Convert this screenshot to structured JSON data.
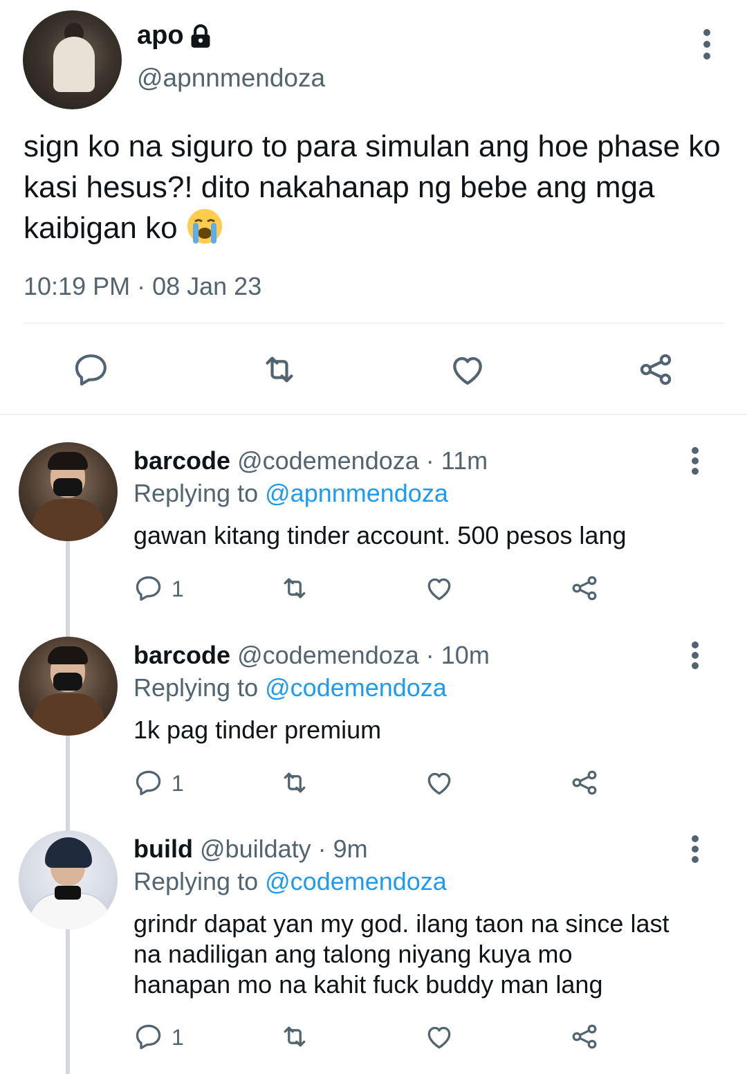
{
  "main_tweet": {
    "name": "apo",
    "handle": "@apnnmendoza",
    "text": "sign ko na siguro to para simulan ang hoe phase ko kasi hesus?! dito nakahanap ng bebe ang mga kaibigan ko",
    "emoji": "loudly-crying-face",
    "timestamp": "10:19 PM · 08 Jan 23",
    "icons": [
      "lock-icon",
      "more-icon",
      "reply-icon",
      "retweet-icon",
      "like-icon",
      "share-icon"
    ]
  },
  "replies": [
    {
      "name": "barcode",
      "handle": "@codemendoza",
      "time": "· 11m",
      "replying_label": "Replying to",
      "replying_to": "@apnnmendoza",
      "text": "gawan kitang tinder account. 500 pesos lang",
      "reply_count": "1"
    },
    {
      "name": "barcode",
      "handle": "@codemendoza",
      "time": "· 10m",
      "replying_label": "Replying to",
      "replying_to": "@codemendoza",
      "text": "1k pag tinder premium",
      "reply_count": "1"
    },
    {
      "name": "build",
      "handle": "@buildaty",
      "time": "· 9m",
      "replying_label": "Replying to",
      "replying_to": "@codemendoza",
      "text": "grindr dapat yan my god. ilang taon na since last na nadiligan ang talong niyang kuya mo hanapan mo na kahit fuck buddy man lang",
      "reply_count": "1"
    }
  ],
  "colors": {
    "text": "#0f1419",
    "secondary": "#536471",
    "accent": "#1d9bf0",
    "divider": "#eff3f4",
    "thread_line": "#cfd9de"
  }
}
